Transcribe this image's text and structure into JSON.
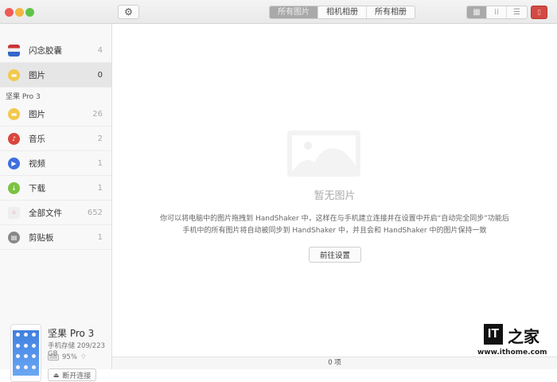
{
  "window": {
    "controls": [
      "close",
      "minimize",
      "zoom"
    ]
  },
  "toolbar": {
    "tabs": [
      {
        "label": "所有图片",
        "active": true
      },
      {
        "label": "相机相册",
        "active": false
      },
      {
        "label": "所有相册",
        "active": false
      }
    ],
    "views": [
      "grid-large",
      "grid-small",
      "list"
    ],
    "active_view": "grid-large"
  },
  "sidebar": {
    "local_items": [
      {
        "label": "闪念胶囊",
        "count": "4",
        "icon": "capsule-icon"
      },
      {
        "label": "图片",
        "count": "0",
        "icon": "photo-icon",
        "selected": true
      }
    ],
    "section_title": "坚果 Pro 3",
    "device_items": [
      {
        "label": "图片",
        "count": "26",
        "icon": "photo-icon",
        "color": "#f2c94c"
      },
      {
        "label": "音乐",
        "count": "2",
        "icon": "music-icon",
        "color": "#d9453c"
      },
      {
        "label": "视频",
        "count": "1",
        "icon": "video-icon",
        "color": "#3f6fe0"
      },
      {
        "label": "下载",
        "count": "1",
        "icon": "download-icon",
        "color": "#7cc242"
      },
      {
        "label": "全部文件",
        "count": "652",
        "icon": "files-icon",
        "color": "#eeeeee"
      },
      {
        "label": "剪贴板",
        "count": "1",
        "icon": "clipboard-icon",
        "color": "#888888"
      }
    ],
    "device": {
      "name": "坚果 Pro 3",
      "storage": "手机存储 209/223 GB",
      "battery": "95%",
      "battery_level": 0.95,
      "disconnect_label": "断开连接"
    }
  },
  "main": {
    "empty_title": "暂无图片",
    "desc_line1": "你可以将电脑中的图片拖拽到 HandShaker 中，这样在与手机建立连接并在设置中开启“自动完全同步”功能后",
    "desc_line2": "手机中的所有图片将自动被同步到 HandShaker 中，并且会和 HandShaker 中的图片保持一致",
    "settings_button": "前往设置"
  },
  "status": {
    "count": "0 项"
  },
  "watermark": {
    "logo_text": "IT之家",
    "url": "www.ithome.com"
  }
}
